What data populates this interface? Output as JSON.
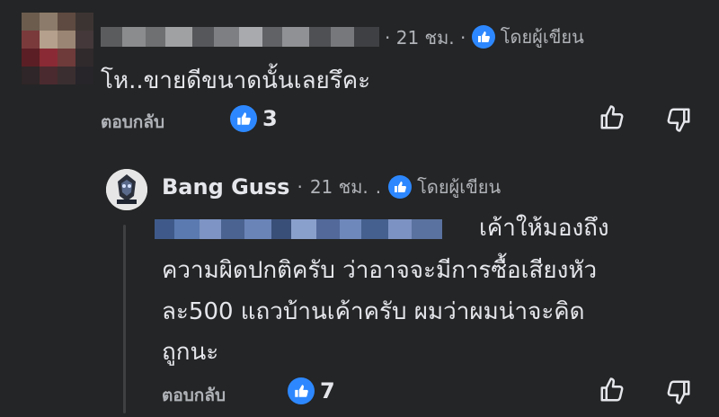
{
  "comment1": {
    "time": "21 ชม.",
    "separator": "·",
    "author_badge": "โดยผู้เขียน",
    "text": "โห..ขายดีขนาดนั้นเลยรึคะ",
    "reply_label": "ตอบกลับ",
    "like_count": "3"
  },
  "comment2": {
    "author": "Bang Guss",
    "separator": "·",
    "time": "21 ชม.",
    "separator2": ".",
    "author_badge": "โดยผู้เขียน",
    "text_line1": "เค้าให้มองถึง",
    "text_line2": "ความผิดปกติครับ ว่าอาจจะมีการซื้อเสียงหัว",
    "text_line3": "ละ500 แถวบ้านเค้าครับ ผมว่าผมน่าจะคิด",
    "text_line4": "ถูกนะ",
    "reply_label": "ตอบกลับ",
    "like_count": "7"
  },
  "colors": {
    "background": "#242526",
    "accent": "#2d88ff",
    "text": "#e4e6eb",
    "muted": "#b0b3b8"
  }
}
